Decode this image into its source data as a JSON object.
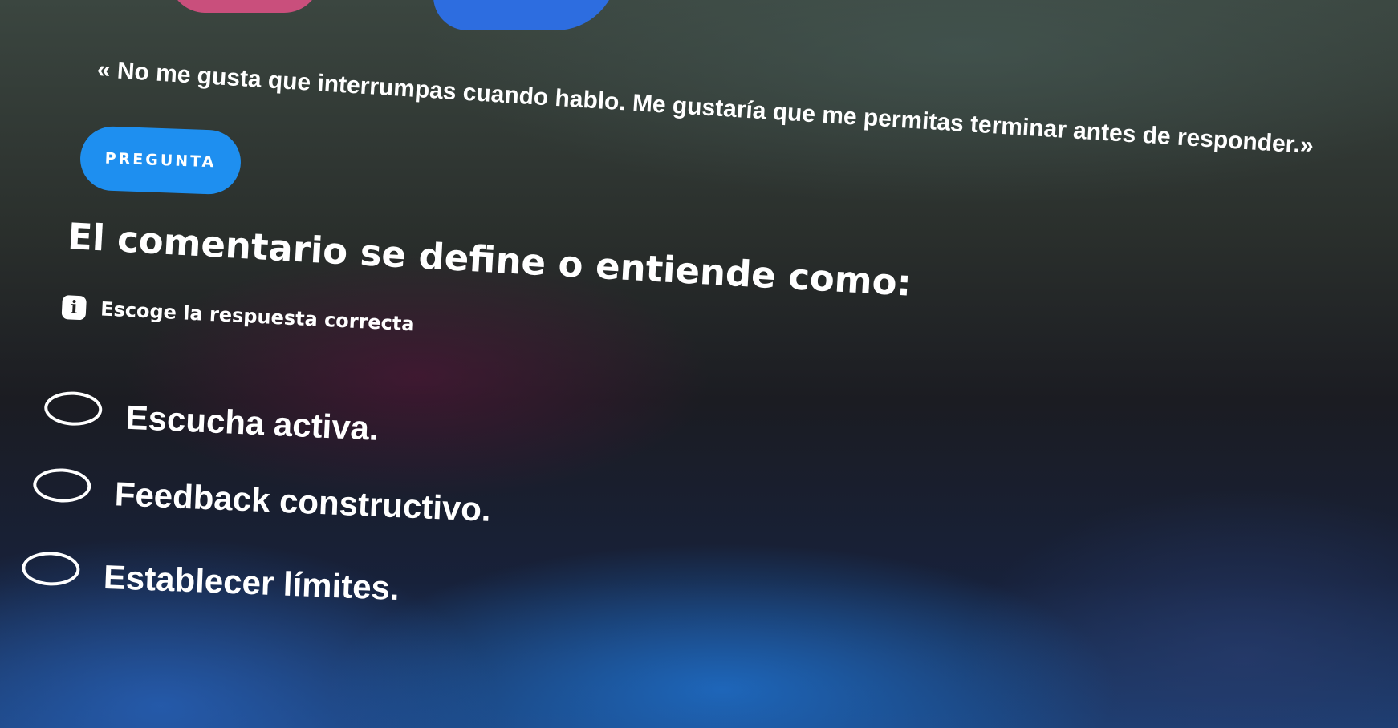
{
  "question": {
    "badge": "PREGUNTA",
    "quote": "« No me gusta que interrumpas cuando hablo. Me gustaría que me permitas terminar antes de responder.»",
    "prompt": "El comentario se define o entiende como:",
    "hint_icon": "i",
    "hint": "Escoge la respuesta correcta"
  },
  "options": [
    {
      "label": "Escucha activa."
    },
    {
      "label": "Feedback constructivo."
    },
    {
      "label": "Establecer límites."
    }
  ],
  "colors": {
    "badge_bg": "#1e8ff0",
    "text": "#ffffff"
  }
}
